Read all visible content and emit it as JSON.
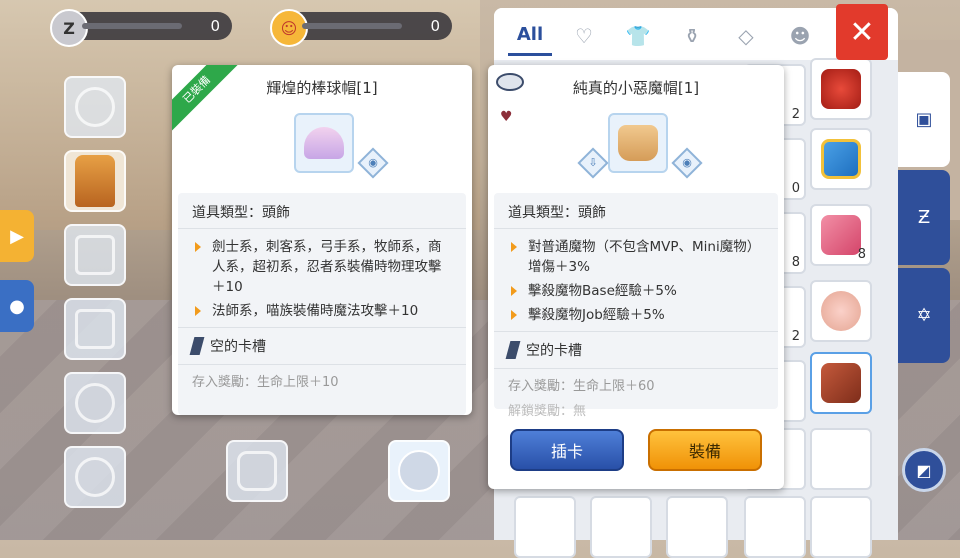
{
  "currencies": [
    {
      "icon": "zeny-coin-icon",
      "label": "Z",
      "value": "0"
    },
    {
      "icon": "poring-coin-icon",
      "label": "☺",
      "value": "0"
    }
  ],
  "inventory_tabs": [
    {
      "id": "all",
      "label": "All",
      "icon": "all-icon"
    },
    {
      "id": "favorite",
      "label": "♡",
      "icon": "heart-icon"
    },
    {
      "id": "equipment",
      "label": "👕",
      "icon": "shirt-icon"
    },
    {
      "id": "consumable",
      "label": "⚱",
      "icon": "potion-icon"
    },
    {
      "id": "gem",
      "label": "◇",
      "icon": "diamond-icon"
    },
    {
      "id": "card",
      "label": "☻",
      "icon": "card-icon"
    }
  ],
  "close_label": "✕",
  "left_card": {
    "ribbon": "已裝備",
    "title": "輝煌的棒球帽[1]",
    "type_line": "道具類型：頭飾",
    "bullets": [
      "劍士系，刺客系，弓手系，牧師系，商人系，超初系，忍者系裝備時物理攻擊＋10",
      "法師系，喵族裝備時魔法攻擊＋10"
    ],
    "card_slot": "空的卡槽",
    "reward": "存入獎勵：生命上限＋10"
  },
  "right_card": {
    "title": "純真的小惡魔帽[1]",
    "type_line": "道具類型：頭飾",
    "bullets": [
      "對普通魔物（不包含MVP、Mini魔物）增傷＋3%",
      "擊殺魔物Base經驗＋5%",
      "擊殺魔物Job經驗＋5%"
    ],
    "card_slot": "空的卡槽",
    "reward": "存入獎勵：生命上限＋60",
    "reward2": "解鎖獎勵：無",
    "buttons": {
      "insert_card": "插卡",
      "equip": "裝備"
    }
  },
  "inventory_counts": [
    "2",
    "0",
    "8",
    "8",
    "2"
  ],
  "colors": {
    "accent_blue": "#2b4f9c",
    "close_red": "#e23a2c",
    "equip_orange": "#f09207",
    "equipped_green": "#2ea84a"
  }
}
